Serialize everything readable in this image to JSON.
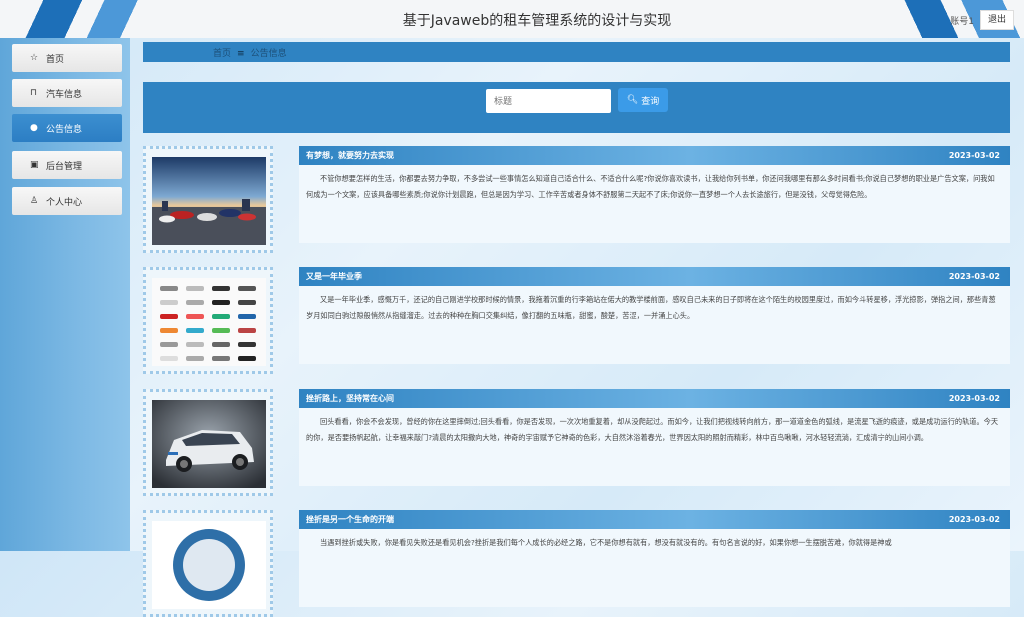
{
  "header": {
    "title": "基于Javaweb的租车管理系统的设计与实现",
    "account": "账号1",
    "logout": "退出"
  },
  "sidebar": {
    "items": [
      {
        "label": "首页",
        "icon": "star-icon",
        "active": false
      },
      {
        "label": "汽车信息",
        "icon": "bag-icon",
        "active": false
      },
      {
        "label": "公告信息",
        "icon": "info-icon",
        "active": true
      },
      {
        "label": "后台管理",
        "icon": "cabinet-icon",
        "active": false
      },
      {
        "label": "个人中心",
        "icon": "user-icon",
        "active": false
      }
    ]
  },
  "breadcrumb": {
    "home": "首页",
    "current": "公告信息"
  },
  "search": {
    "placeholder": "标题",
    "button": "查询"
  },
  "colors": {
    "primary": "#2f83c2",
    "active_nav": "#2c7ec4",
    "button": "#3b9be8"
  },
  "news": [
    {
      "title": "有梦想，就要努力去实现",
      "date": "2023-03-02",
      "image": "cars-parking-lot-image",
      "content": "不管你想要怎样的生活，你都要去努力争取，不多尝试一些事情怎么知道自己适合什么、不适合什么呢?你说你喜欢读书，让我给你列书单，你还问我哪里有那么多时间看书;你说自己梦想的职业是广告文案，问我如何成为一个文案，应该具备哪些素质;你说你计划晨跑，但总是因为学习、工作辛苦或者身体不舒服第二天起不了床;你说你一直梦想一个人去长途旅行，但是没钱，父母觉得危险。"
    },
    {
      "title": "又是一年毕业季",
      "date": "2023-03-02",
      "image": "car-collection-image",
      "content": "又是一年毕业季，感慨万千，还记的自己刚进学校那时候的情景，我拖着沉重的行李箱站在偌大的教学楼前面，感叹自己未来的日子即将在这个陌生的校园里度过，而如今斗转星移，浮光掠影，弹指之间，那些青葱岁月如同白驹过隙般悄然从指缝溜走。过去的种种在胸口交集纠结，像打翻的五味瓶，甜蜜，酸楚，苦涩，一并涌上心头。"
    },
    {
      "title": "挫折路上，坚持常在心间",
      "date": "2023-03-02",
      "image": "white-suv-image",
      "content": "回头看看，你会不会发现，曾经的你在这里摔倒过;回头看看，你是否发现，一次次地重复着，却从没爬起过。而如今，让我们把视线转向前方，那一道道金色的弧线，是流星飞逝的痕迹，或是成功运行的轨道。今天的你，是否要扬帆起航，让幸福来敲门?清晨的太阳撒向大地，神奇的宇宙赋予它神奇的色彩，大自然沐浴着春光，世界因太阳的照射而精彩，林中百鸟啾啾，河水轻轻流淌，汇成清宁的山间小调。"
    },
    {
      "title": "挫折是另一个生命的开端",
      "date": "2023-03-02",
      "image": "steering-wheel-image",
      "content": "当遇到挫折或失败，你是看见失败还是看见机会?挫折是我们每个人成长的必经之路，它不是你想有就有，想没有就没有的。有句名言说的好，如果你想一生摆脱苦难，你就得是神或"
    }
  ]
}
